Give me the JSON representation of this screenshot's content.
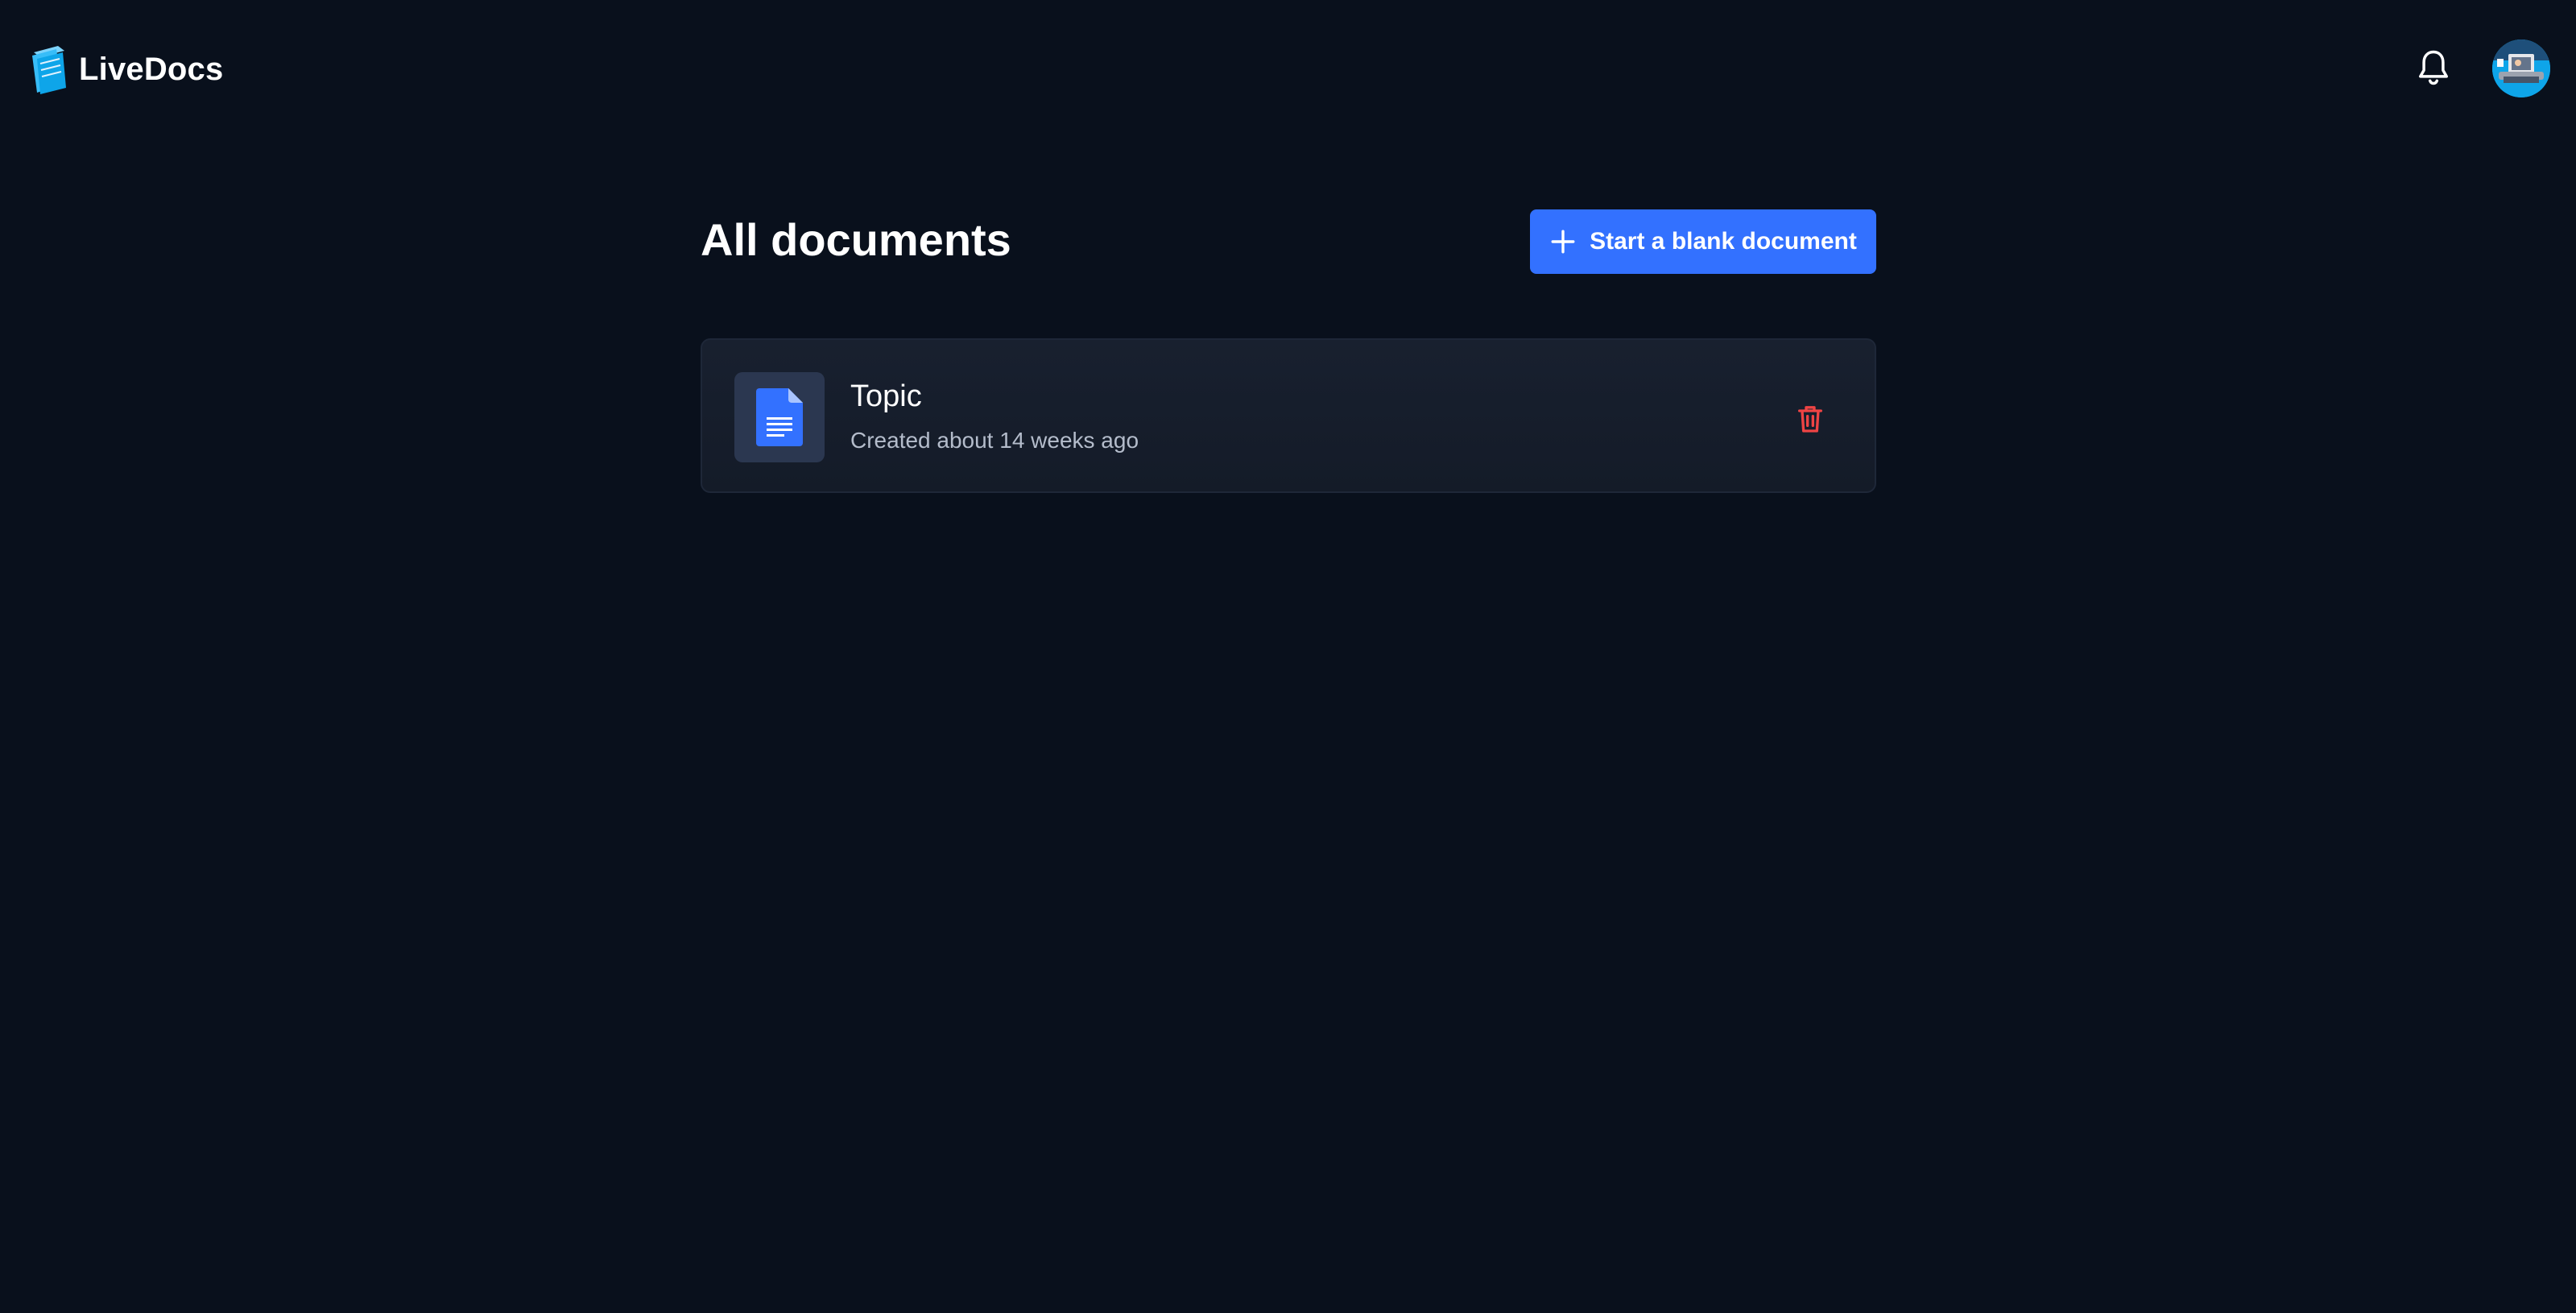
{
  "header": {
    "brand_name": "LiveDocs",
    "logo_icon": "livedocs-logo-icon",
    "notification_icon": "bell-icon",
    "avatar_icon": "user-avatar"
  },
  "main": {
    "title": "All documents",
    "new_document_button": {
      "label": "Start a blank document",
      "icon": "plus-icon"
    },
    "documents": [
      {
        "title": "Topic",
        "created": "Created about 14 weeks ago",
        "icon": "document-icon",
        "delete_icon": "trash-icon"
      }
    ]
  },
  "colors": {
    "background": "#09101c",
    "accent": "#3371ff",
    "card": "#161d2b",
    "danger": "#ef4444",
    "muted_text": "#b4bccb"
  }
}
